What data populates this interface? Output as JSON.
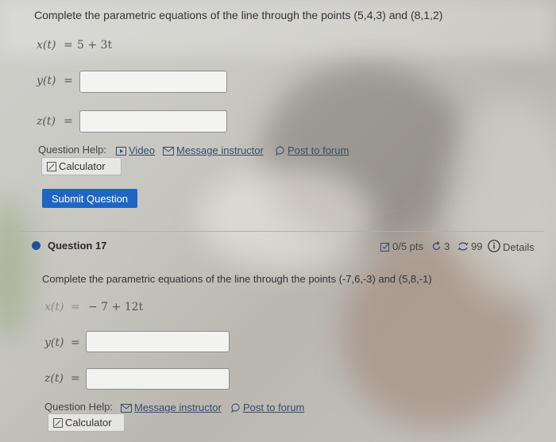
{
  "question_prev": {
    "prompt": "Complete the parametric equations of the line through the points (5,4,3) and (8,1,2)",
    "x_label": "x(t)",
    "eq_sign": "=",
    "x_value": "5 + 3t",
    "y_label": "y(t)",
    "z_label": "z(t)",
    "y_input_value": "",
    "z_input_value": "",
    "help_label": "Question Help:",
    "video_link": "Video",
    "message_link": "Message instructor",
    "forum_link": "Post to forum",
    "calculator_label": "Calculator",
    "submit_label": "Submit Question"
  },
  "question_17": {
    "title": "Question 17",
    "points": "0/5 pts",
    "retries": "3",
    "attempts": "99",
    "details_label": "Details",
    "prompt": "Complete the parametric equations of the line through the points (-7,6,-3) and (5,8,-1)",
    "x_label": "x(t)",
    "eq_sign": "=",
    "x_value": "− 7 + 12t",
    "y_label": "y(t)",
    "z_label": "z(t)",
    "y_input_value": "",
    "z_input_value": "",
    "help_label": "Question Help:",
    "message_link": "Message instructor",
    "forum_link": "Post to forum",
    "calculator_label": "Calculator"
  },
  "colors": {
    "submit_bg": "#1f66c2",
    "question_dot": "#1d4fa0",
    "link_text": "#3a4a6a"
  },
  "icons": [
    "video-icon",
    "mail-icon",
    "forum-icon",
    "calculator-icon",
    "edit-pts-icon",
    "retry-icon",
    "attempts-icon",
    "info-icon"
  ]
}
